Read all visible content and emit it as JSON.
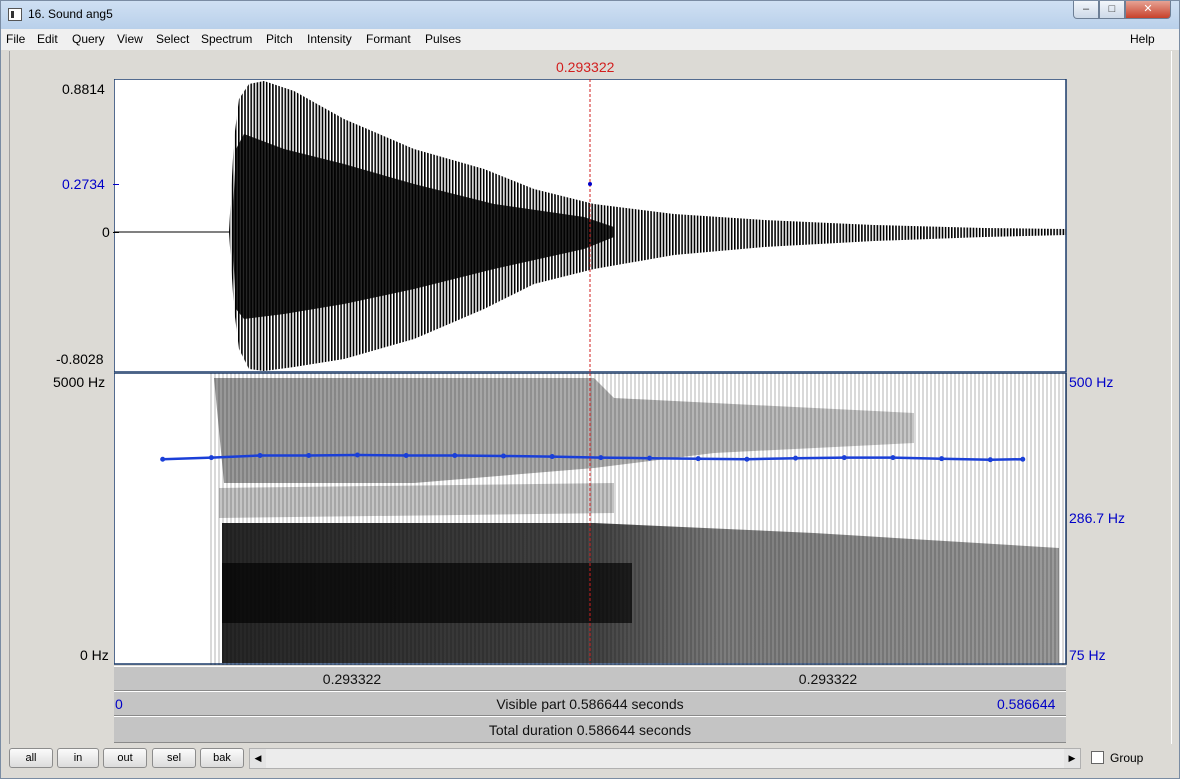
{
  "window": {
    "title": "16. Sound ang5",
    "minimize": "‒",
    "maximize": "□",
    "close": "✕"
  },
  "menu": {
    "items": [
      "File",
      "Edit",
      "Query",
      "View",
      "Select",
      "Spectrum",
      "Pitch",
      "Intensity",
      "Formant",
      "Pulses"
    ],
    "help": "Help"
  },
  "cursor": {
    "time_label": "0.293322"
  },
  "waveform": {
    "max_label": "0.8814",
    "cursor_value_label": "0.2734",
    "zero_label": "0",
    "min_label": "-0.8028"
  },
  "spectrogram": {
    "top_label": "5000 Hz",
    "bottom_label": "0 Hz",
    "pitch_top_label": "500 Hz",
    "pitch_cursor_label": "286.7 Hz",
    "pitch_bottom_label": "75 Hz"
  },
  "pitch_track": {
    "x": [
      0.03,
      0.06,
      0.09,
      0.12,
      0.15,
      0.18,
      0.21,
      0.24,
      0.27,
      0.3,
      0.33,
      0.36,
      0.39,
      0.42,
      0.45,
      0.48,
      0.51,
      0.54,
      0.56
    ],
    "y": [
      285,
      288,
      292,
      292,
      293,
      292,
      292,
      291,
      290,
      288,
      287,
      286,
      285,
      287,
      288,
      288,
      286,
      284,
      285
    ]
  },
  "time_bar": {
    "left_segment": "0.293322",
    "right_segment": "0.293322",
    "start_label": "0",
    "visible_label": "Visible part 0.586644 seconds",
    "end_label": "0.586644",
    "total_label": "Total duration 0.586644 seconds"
  },
  "bottom": {
    "buttons": [
      "all",
      "in",
      "out",
      "sel",
      "bak"
    ],
    "scroll_left": "◀",
    "scroll_right": "▶",
    "group_label": "Group"
  },
  "colors": {
    "pitch": "#1a3fd8",
    "cursor": "#d21e1e",
    "axis_blue": "#0000c8"
  }
}
